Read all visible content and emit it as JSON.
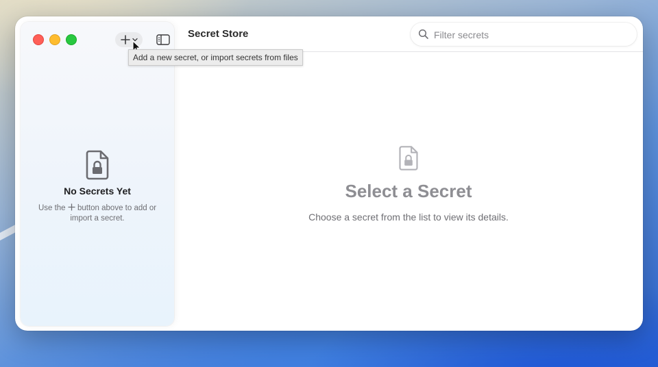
{
  "window": {
    "title": "Secret Store"
  },
  "toolbar": {
    "add_icon": "plus-icon",
    "add_menu_icon": "chevron-down-icon",
    "sidebar_toggle_icon": "sidebar-icon",
    "tooltip": "Add a new secret, or import secrets from files"
  },
  "search": {
    "placeholder": "Filter secrets",
    "value": "",
    "icon": "magnifier-icon"
  },
  "sidebar": {
    "empty_icon": "locked-document-icon",
    "empty_title": "No Secrets Yet",
    "empty_text_before": "Use the ",
    "empty_text_after": " button above to add or import a secret."
  },
  "detail": {
    "empty_icon": "locked-document-icon",
    "empty_title": "Select a Secret",
    "empty_text": "Choose a secret from the list to view its details."
  },
  "colors": {
    "close": "#ff5f57",
    "minimize": "#febc2e",
    "maximize": "#28c840"
  }
}
